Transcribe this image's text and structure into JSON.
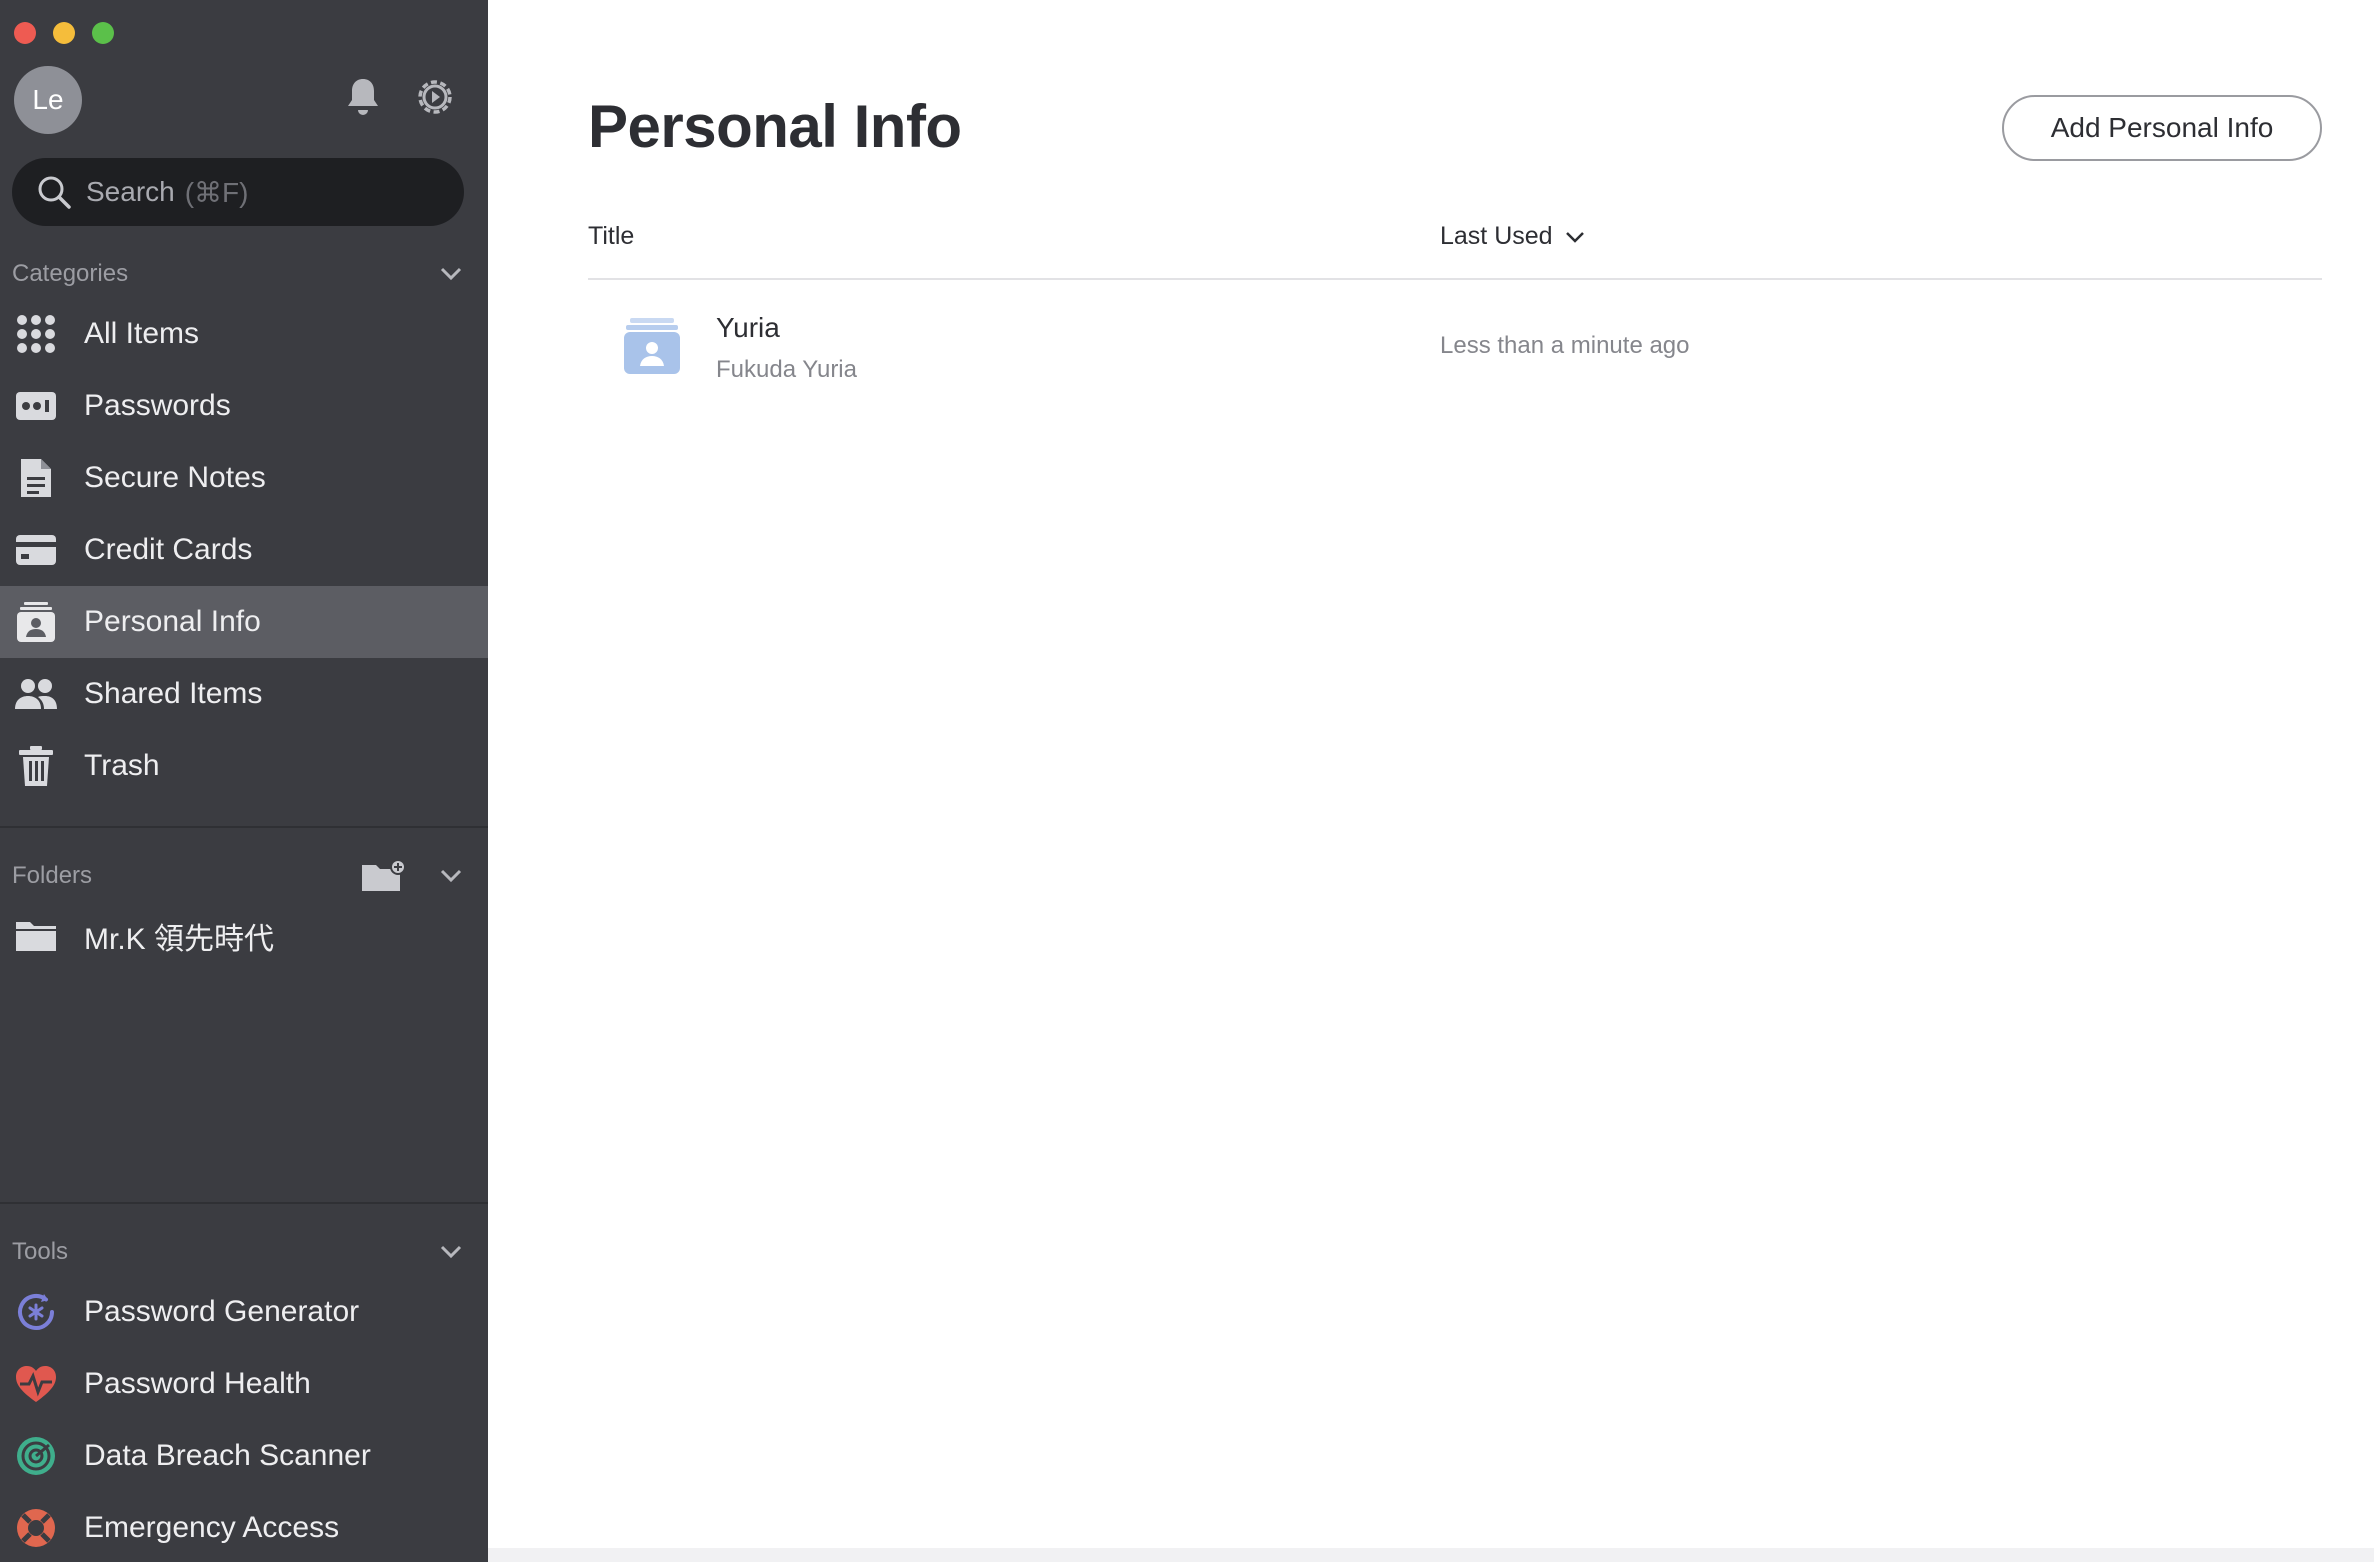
{
  "window": {
    "controls": [
      "close",
      "minimize",
      "maximize"
    ]
  },
  "user": {
    "initials": "Le"
  },
  "search": {
    "placeholder": "Search",
    "shortcut": "(⌘F)"
  },
  "sidebar": {
    "categories_label": "Categories",
    "categories": [
      {
        "label": "All Items",
        "icon": "grid-icon"
      },
      {
        "label": "Passwords",
        "icon": "password-icon"
      },
      {
        "label": "Secure Notes",
        "icon": "note-icon"
      },
      {
        "label": "Credit Cards",
        "icon": "credit-card-icon"
      },
      {
        "label": "Personal Info",
        "icon": "personal-info-icon",
        "active": true
      },
      {
        "label": "Shared Items",
        "icon": "people-icon"
      },
      {
        "label": "Trash",
        "icon": "trash-icon"
      }
    ],
    "folders_label": "Folders",
    "folders": [
      {
        "label": "Mr.K 領先時代",
        "icon": "folder-icon"
      }
    ],
    "tools_label": "Tools",
    "tools": [
      {
        "label": "Password Generator",
        "icon": "password-generator-icon",
        "color": "#7b7fd8"
      },
      {
        "label": "Password Health",
        "icon": "heart-pulse-icon",
        "color": "#e0584f"
      },
      {
        "label": "Data Breach Scanner",
        "icon": "radar-icon",
        "color": "#3fae8c"
      },
      {
        "label": "Emergency Access",
        "icon": "lifebuoy-icon",
        "color": "#e0674f"
      }
    ]
  },
  "main": {
    "title": "Personal Info",
    "add_button": "Add Personal Info",
    "columns": {
      "title": "Title",
      "last_used": "Last Used"
    },
    "items": [
      {
        "title": "Yuria",
        "subtitle": "Fukuda Yuria",
        "last_used": "Less than a minute ago",
        "icon": "contact-card-icon"
      }
    ]
  },
  "colors": {
    "sidebar_bg": "#3b3c41",
    "active_bg": "#5c5d63",
    "accent_icon": "#a9c3ea"
  }
}
